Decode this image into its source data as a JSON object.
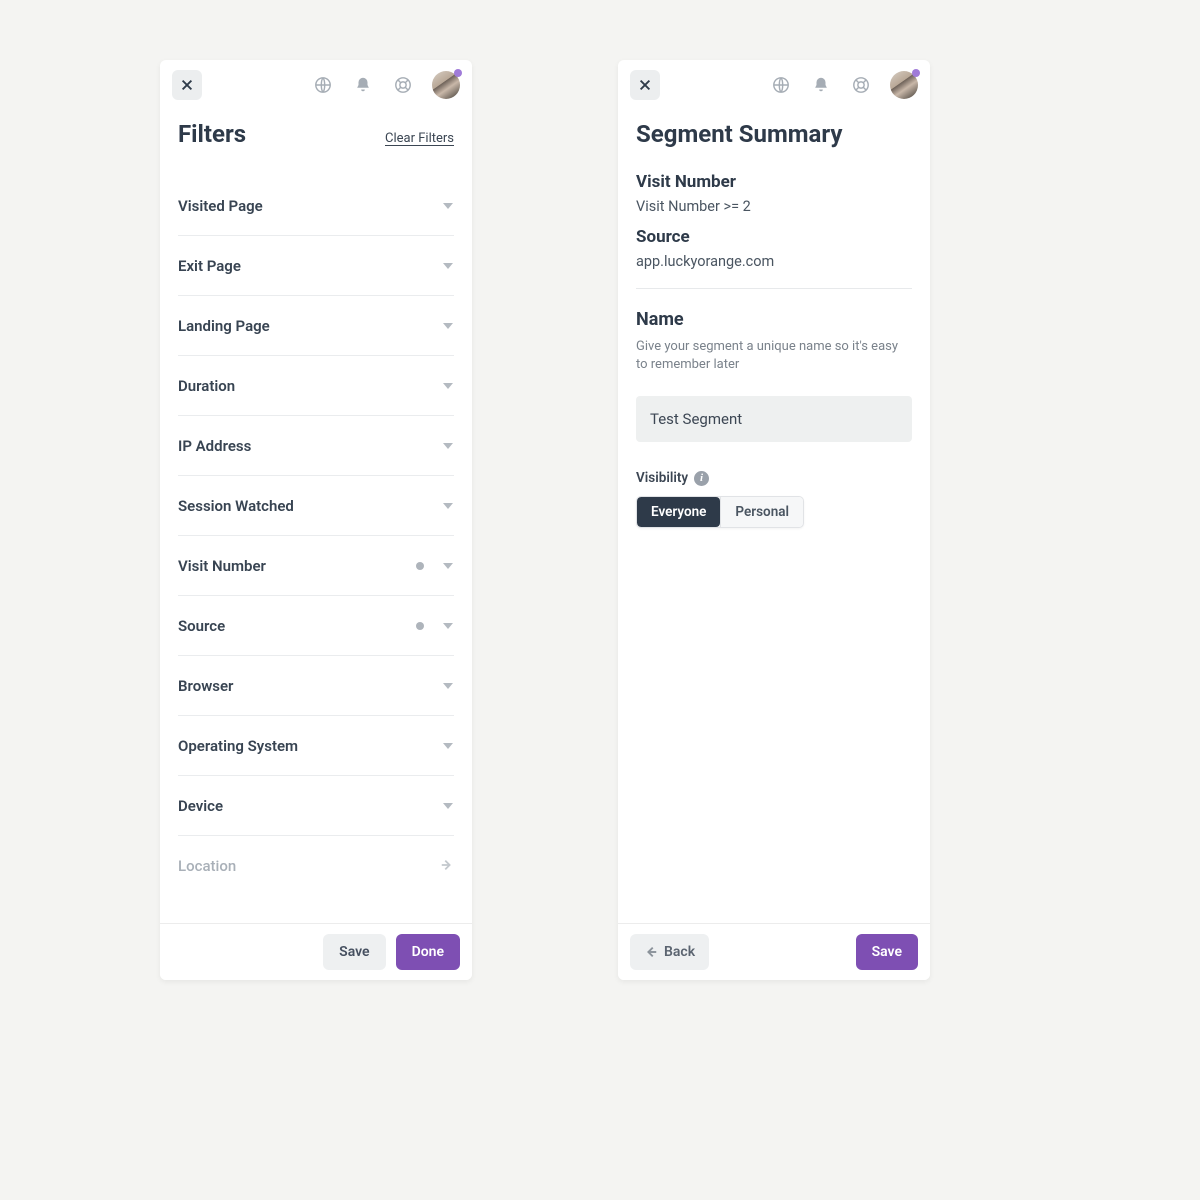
{
  "left": {
    "title": "Filters",
    "clear_label": "Clear Filters",
    "filters": [
      {
        "label": "Visited Page",
        "active": false,
        "kind": "dropdown"
      },
      {
        "label": "Exit Page",
        "active": false,
        "kind": "dropdown"
      },
      {
        "label": "Landing Page",
        "active": false,
        "kind": "dropdown"
      },
      {
        "label": "Duration",
        "active": false,
        "kind": "dropdown"
      },
      {
        "label": "IP Address",
        "active": false,
        "kind": "dropdown"
      },
      {
        "label": "Session Watched",
        "active": false,
        "kind": "dropdown"
      },
      {
        "label": "Visit Number",
        "active": true,
        "kind": "dropdown"
      },
      {
        "label": "Source",
        "active": true,
        "kind": "dropdown"
      },
      {
        "label": "Browser",
        "active": false,
        "kind": "dropdown"
      },
      {
        "label": "Operating System",
        "active": false,
        "kind": "dropdown"
      },
      {
        "label": "Device",
        "active": false,
        "kind": "dropdown"
      },
      {
        "label": "Location",
        "active": false,
        "kind": "link",
        "muted": true
      }
    ],
    "footer": {
      "save": "Save",
      "done": "Done"
    }
  },
  "right": {
    "title": "Segment Summary",
    "criteria": [
      {
        "heading": "Visit Number",
        "value": "Visit Number >= 2"
      },
      {
        "heading": "Source",
        "value": "app.luckyorange.com"
      }
    ],
    "name_heading": "Name",
    "name_desc": "Give your segment a unique name so it's easy to remember later",
    "name_value": "Test Segment",
    "visibility_label": "Visibility",
    "visibility_options": [
      "Everyone",
      "Personal"
    ],
    "visibility_selected": "Everyone",
    "footer": {
      "back": "Back",
      "save": "Save"
    }
  },
  "colors": {
    "accent": "#7e4fb3",
    "text": "#2e3a49"
  }
}
